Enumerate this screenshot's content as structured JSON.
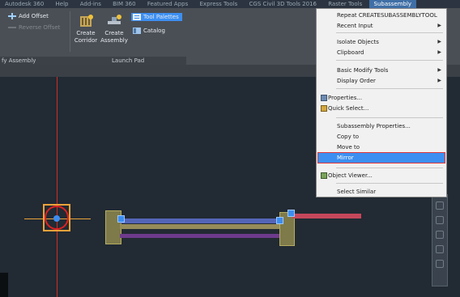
{
  "tabs": [
    "Autodesk 360",
    "Help",
    "Add-ins",
    "BIM 360",
    "Featured Apps",
    "Express Tools",
    "CGS Civil 3D Tools 2016",
    "Raster Tools",
    "Subassembly"
  ],
  "ribbon": {
    "add_offset": "Add Offset",
    "faded_option": "Reverse Offset",
    "create_corridor": "Create Corridor",
    "create_assembly": "Create Assembly",
    "tool_palettes": "Tool Palettes",
    "catalog": "Catalog",
    "panel_modify": "fy Assembly",
    "panel_launch": "Launch Pad"
  },
  "context_menu": {
    "items": [
      {
        "label": "Repeat CREATESUBASSEMBLYTOOL",
        "submenu": false,
        "icon": ""
      },
      {
        "label": "Recent Input",
        "submenu": true,
        "icon": ""
      },
      {
        "label": "Isolate Objects",
        "submenu": true,
        "icon": ""
      },
      {
        "label": "Clipboard",
        "submenu": true,
        "icon": ""
      },
      {
        "label": "Basic Modify Tools",
        "submenu": true,
        "icon": ""
      },
      {
        "label": "Display Order",
        "submenu": true,
        "icon": ""
      },
      {
        "label": "Properties...",
        "submenu": false,
        "icon": "properties-icon"
      },
      {
        "label": "Quick Select...",
        "submenu": false,
        "icon": "quick-select-icon"
      },
      {
        "label": "Subassembly Properties...",
        "submenu": false,
        "icon": ""
      },
      {
        "label": "Copy to",
        "submenu": false,
        "icon": ""
      },
      {
        "label": "Move to",
        "submenu": false,
        "icon": ""
      },
      {
        "label": "Mirror",
        "submenu": false,
        "icon": "",
        "highlighted": true
      },
      {
        "label": "Object Viewer...",
        "submenu": false,
        "icon": "object-viewer-icon"
      },
      {
        "label": "Select Similar",
        "submenu": false,
        "icon": ""
      }
    ],
    "highlight_color": "#3c8ff1",
    "highlight_outline": "#e0373b"
  },
  "colors": {
    "viewport_bg": "#222a33",
    "cursor_vertical": "#cf2d24",
    "assembly_marker": "#f3a23a",
    "grip": "#3d8df0"
  }
}
